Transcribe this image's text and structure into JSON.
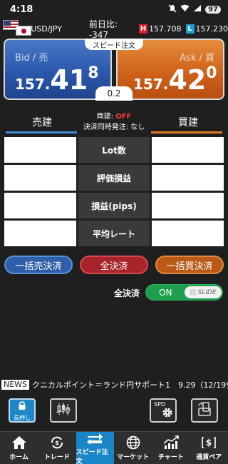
{
  "status": {
    "time": "4:18",
    "battery": "97"
  },
  "header": {
    "pair": "USD/JPY",
    "prev_day": "前日比: -347",
    "high_tag": "H",
    "high": "157.708",
    "low_tag": "L",
    "low": "157.230"
  },
  "quotes": {
    "speed_tab": "スピード注文",
    "bid_label": "Bid / 売",
    "bid_p1": "157.",
    "bid_p2": "41",
    "bid_p3": "8",
    "ask_label": "Ask / 買",
    "ask_p1": "157.",
    "ask_p2": "42",
    "ask_p3": "0",
    "spread": "0.2"
  },
  "trade": {
    "sell": "売建",
    "buy": "買建",
    "ryodate_label": "両建: ",
    "ryodate_value": "OFF",
    "simultaneous": "決済同時発注: なし"
  },
  "grid": {
    "rows": [
      {
        "label": "Lot数"
      },
      {
        "label": "評価損益"
      },
      {
        "label": "損益(pips)"
      },
      {
        "label": "平均レート"
      }
    ]
  },
  "buttons": {
    "sell_all": "一括売決済",
    "all": "全決済",
    "buy_all": "一括買決済"
  },
  "all_settle": {
    "label": "全決済",
    "toggle": "ON",
    "slide": "SLIDE"
  },
  "news": {
    "tag": "NEWS",
    "ticker": "クニカルポイント＝ランド円サポート1　9.29（12/19気"
  },
  "tools": {
    "lock_label": "長押し",
    "spd_label": "SPD"
  },
  "tabs": [
    {
      "label": "ホーム",
      "icon": "home-icon"
    },
    {
      "label": "トレード",
      "icon": "trade-icon"
    },
    {
      "label": "スピード注文",
      "icon": "speed-order-icon"
    },
    {
      "label": "マーケット",
      "icon": "globe-icon"
    },
    {
      "label": "チャート",
      "icon": "chart-icon"
    },
    {
      "label": "通貨ペア",
      "icon": "currency-pair-icon"
    }
  ],
  "colors": {
    "bid": "#2b58ac",
    "ask": "#d0621a",
    "active_tab": "#1b86c7",
    "toggle_on": "#1e9e4e"
  }
}
